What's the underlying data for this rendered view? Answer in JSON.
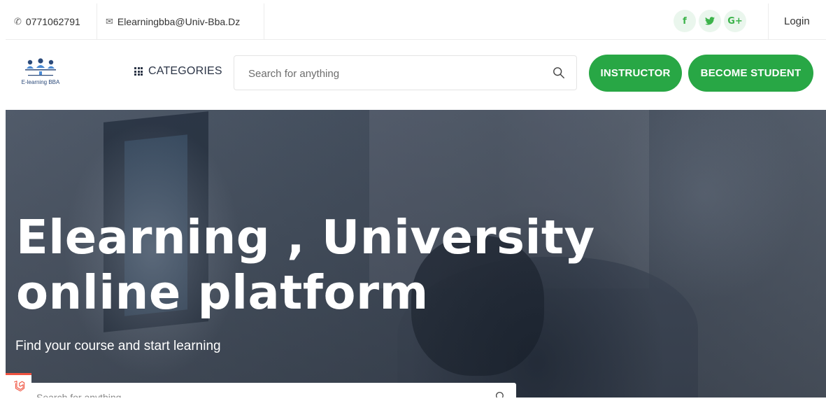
{
  "topbar": {
    "phone": "0771062791",
    "email": "Elearningbba@Univ-Bba.Dz",
    "socials": [
      {
        "label": "f",
        "icon": "facebook-icon"
      },
      {
        "label": "𝕪",
        "icon": "twitter-icon"
      },
      {
        "label": "G+",
        "icon": "google-plus-icon"
      }
    ],
    "login": "Login"
  },
  "navbar": {
    "logo_text": "E-learning BBA",
    "categories": "CATEGORIES",
    "search_placeholder": "Search for anything",
    "instructor": "INSTRUCTOR",
    "become_student": "BECOME STUDENT"
  },
  "hero": {
    "title_line1": "Elearning , University",
    "title_line2": "online platform",
    "subtitle": "Find your course and start learning",
    "search_placeholder": "Search for anything"
  },
  "colors": {
    "accent": "#28a745",
    "social_bg": "#eaf6ed",
    "laravel": "#f05340"
  }
}
